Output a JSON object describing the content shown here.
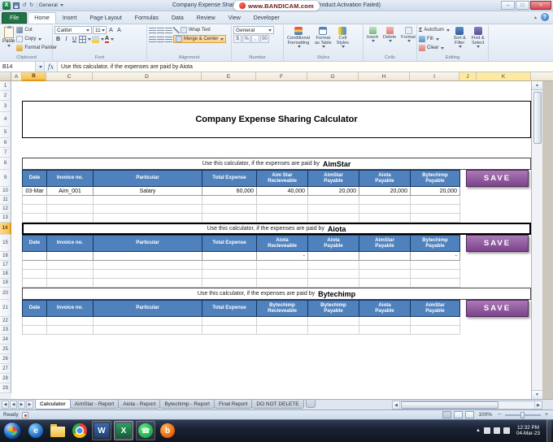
{
  "colors": {
    "header_blue": "#4f81bd",
    "save_purple": "#8e4d9e",
    "file_green": "#217346",
    "select_amber": "#f6c04e",
    "tint_yellow": "#ffe9a0"
  },
  "icons": {
    "sigma": "Σ",
    "undo": "↺",
    "redo": "↻",
    "help": "?",
    "minimize": "–",
    "maximize": "□",
    "close": "×",
    "dollar": "$",
    "percent": "%",
    "comma": ",",
    "decimal": "00",
    "nav_prev": "◀",
    "nav_next": "▶",
    "scroll_up": "▲",
    "scroll_down": "▼",
    "scroll_left": "◀",
    "scroll_right": "▶",
    "tray_chevron": "▲",
    "chevron_up": "▴",
    "excel_letter": "X",
    "word_letter": "W",
    "phone": "☎",
    "bandicam_letter": "b",
    "browser_letter": "e",
    "minus": "−",
    "plus": "+"
  },
  "titlebar": {
    "qat_general": "General",
    "title": "Company Expense Sharing Calculator - Microsoft Excel (Product Activation Failed)",
    "watermark_text": "www.BANDICAM.com"
  },
  "ribbon": {
    "tabs": [
      {
        "label": "File"
      },
      {
        "label": "Home",
        "active": true
      },
      {
        "label": "Insert"
      },
      {
        "label": "Page Layout"
      },
      {
        "label": "Formulas"
      },
      {
        "label": "Data"
      },
      {
        "label": "Review"
      },
      {
        "label": "View"
      },
      {
        "label": "Developer"
      }
    ],
    "clipboard": {
      "label": "Clipboard",
      "paste": "Paste",
      "cut": "Cut",
      "copy": "Copy",
      "format_painter": "Format Painter"
    },
    "font": {
      "label": "Font",
      "name": "Calibri",
      "size": "11",
      "bold": "B",
      "italic": "I",
      "underline": "U",
      "grow": "A",
      "shrink": "A",
      "color_letter": "A"
    },
    "alignment": {
      "label": "Alignment",
      "wrap": "Wrap Text",
      "merge": "Merge & Center"
    },
    "number": {
      "label": "Number",
      "format": "General"
    },
    "styles": {
      "label": "Styles",
      "conditional_1": "Conditional",
      "conditional_2": "Formatting",
      "table_1": "Format",
      "table_2": "as Table",
      "cellstyles_1": "Cell",
      "cellstyles_2": "Styles"
    },
    "cells": {
      "label": "Cells",
      "insert": "Insert",
      "delete": "Delete",
      "format": "Format"
    },
    "editing": {
      "label": "Editing",
      "autosum": "AutoSum",
      "fill": "Fill",
      "clear": "Clear",
      "sort": "Sort & Filter",
      "find": "Find & Select"
    }
  },
  "formula_bar": {
    "cell_ref": "B14",
    "fx_label": "fx",
    "content": "Use this calculator, if the expenses are paid by Aiota"
  },
  "grid": {
    "col_headers": [
      "A",
      "B",
      "C",
      "D",
      "E",
      "F",
      "G",
      "H",
      "I",
      "J",
      "K"
    ],
    "selected_col": "B",
    "tinted_cols": [
      "J",
      "K"
    ],
    "row_numbers": [
      "1",
      "2",
      "3",
      "4",
      "5",
      "6",
      "7",
      "8",
      "9",
      "10",
      "11",
      "12",
      "13",
      "14",
      "15",
      "16",
      "17",
      "18",
      "19",
      "20",
      "21",
      "22",
      "23",
      "24",
      "25",
      "26",
      "27",
      "28",
      "29"
    ],
    "selected_row": "14",
    "title": "Company Expense Sharing Calculator",
    "sections": [
      {
        "intro_prefix": "Use this calculator, if the expenses are paid by ",
        "company": "AimStar",
        "headers": [
          [
            "Date"
          ],
          [
            "Invoice no."
          ],
          [
            "Particular"
          ],
          [
            "Total Expense"
          ],
          [
            "Aim Star",
            "Recieveable"
          ],
          [
            "AimStar",
            "Payable"
          ],
          [
            "Aiota",
            "Payable"
          ],
          [
            "Bytechimp",
            "Payable"
          ]
        ],
        "save_label": "SAVE",
        "data_rows": [
          [
            "03-Mar",
            "Aim_001",
            "Salary",
            "60,000",
            "40,000",
            "20,000",
            "20,000",
            "20,000"
          ],
          [
            "",
            "",
            "",
            "",
            "",
            "",
            "",
            ""
          ],
          [
            "",
            "",
            "",
            "",
            "",
            "",
            "",
            ""
          ],
          [
            "",
            "",
            "",
            "",
            "",
            "",
            "",
            ""
          ]
        ]
      },
      {
        "intro_prefix": "Use this calculator, if the expenses are paid by ",
        "company": "Aiota",
        "headers": [
          [
            "Date"
          ],
          [
            "Invoice no."
          ],
          [
            "Particular"
          ],
          [
            "Total Expense"
          ],
          [
            "Aiota",
            "Recieveable"
          ],
          [
            "Aiota",
            "Payable"
          ],
          [
            "AimStar",
            "Payable"
          ],
          [
            "Bytechimp",
            "Payable"
          ]
        ],
        "save_label": "SAVE",
        "data_rows": [
          [
            "",
            "",
            "",
            "",
            "-",
            "",
            "",
            "-"
          ],
          [
            "",
            "",
            "",
            "",
            "",
            "",
            "",
            ""
          ],
          [
            "",
            "",
            "",
            "",
            "",
            "",
            "",
            ""
          ],
          [
            "",
            "",
            "",
            "",
            "",
            "",
            "",
            ""
          ]
        ]
      },
      {
        "intro_prefix": "Use this calculator, if the expenses are paid by ",
        "company": "Bytechimp",
        "headers": [
          [
            "Date"
          ],
          [
            "Invoice no."
          ],
          [
            "Particular"
          ],
          [
            "Total Expense"
          ],
          [
            "Bytechimp",
            "Recieveable"
          ],
          [
            "Bytechimp",
            "Payable"
          ],
          [
            "Aiota",
            "Payable"
          ],
          [
            "AimStar",
            "Payable"
          ]
        ],
        "save_label": "SAVE",
        "data_rows": [
          [
            "",
            "",
            "",
            "",
            "",
            "",
            "",
            ""
          ],
          [
            "",
            "",
            "",
            "",
            "",
            "",
            "",
            ""
          ]
        ]
      }
    ]
  },
  "sheet_tabs": {
    "tabs": [
      {
        "label": "Calculator",
        "active": true
      },
      {
        "label": "AimStar - Report"
      },
      {
        "label": "Aiota - Report"
      },
      {
        "label": "Bytechimp - Report"
      },
      {
        "label": "Final Report"
      },
      {
        "label": "DO NOT DELETE"
      }
    ]
  },
  "status_bar": {
    "mode": "Ready",
    "zoom": "100%"
  },
  "taskbar": {
    "clock_time": "12:32 PM",
    "clock_date": "04-Mar-23",
    "icons": [
      "start-button",
      "browser-icon",
      "explorer-icon",
      "chrome-icon",
      "word-icon",
      "excel-icon",
      "whatsapp-icon",
      "bandicam-icon"
    ]
  }
}
